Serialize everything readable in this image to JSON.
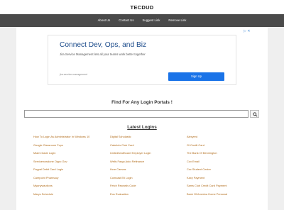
{
  "header": {
    "site_title": "TECDUD"
  },
  "nav": {
    "items": [
      "About Us",
      "Contact Us",
      "Suggest Link",
      "Remove Link"
    ]
  },
  "ad": {
    "title": "Connect Dev, Ops, and Biz",
    "subtitle": "Jira Service Management lets all your teams work better together",
    "url": "jira.service.management",
    "button_label": "Sign Up",
    "corner_label": "▷ ✕"
  },
  "main": {
    "find_heading": "Find For Any Login Portals !",
    "search_placeholder": "",
    "latest_heading": "Latest Logins"
  },
  "latest_logins": [
    [
      "How To Login As Administrator In Windows 10",
      "Digital Scholastic",
      "Alexyred"
    ],
    [
      "Google Classroom Fcps",
      "Cabela's Club Card",
      "Gl Credit Card"
    ],
    [
      "Miami Dade Login",
      "Unitedhealthcare Employer Login",
      "The Bank Of Bennington"
    ],
    [
      "Servicenowdone Oppo Gov",
      "Wells Fargo Auto Refinance",
      "Cox Email"
    ],
    [
      "Paypal Debit Card Login",
      "Hcre Canvas",
      "Csc Student Center"
    ],
    [
      "Carepoint Pharmacy",
      "Comcast Eti Login",
      "Kaxy Payment"
    ],
    [
      "Myanywautions",
      "Fetch Rewards Code",
      "Sams Club Credit Card Payment"
    ],
    [
      "Marys Schedule",
      "Eos Evaluation",
      "Bank Of America Home Personal"
    ]
  ]
}
